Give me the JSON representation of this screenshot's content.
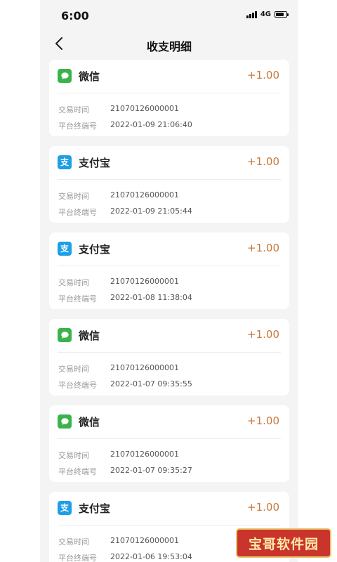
{
  "status_bar": {
    "time": "6:00",
    "network": "4G"
  },
  "header": {
    "title": "收支明细"
  },
  "transactions": [
    {
      "method": "微信",
      "icon": "wechat-icon",
      "amount": "+1.00",
      "label1": "交易时间",
      "value1": "21070126000001",
      "label2": "平台终端号",
      "value2": "2022-01-09 21:06:40"
    },
    {
      "method": "支付宝",
      "icon": "alipay-icon",
      "amount": "+1.00",
      "label1": "交易时间",
      "value1": "21070126000001",
      "label2": "平台终端号",
      "value2": "2022-01-09 21:05:44"
    },
    {
      "method": "支付宝",
      "icon": "alipay-icon",
      "amount": "+1.00",
      "label1": "交易时间",
      "value1": "21070126000001",
      "label2": "平台终端号",
      "value2": "2022-01-08 11:38:04"
    },
    {
      "method": "微信",
      "icon": "wechat-icon",
      "amount": "+1.00",
      "label1": "交易时间",
      "value1": "21070126000001",
      "label2": "平台终端号",
      "value2": "2022-01-07 09:35:55"
    },
    {
      "method": "微信",
      "icon": "wechat-icon",
      "amount": "+1.00",
      "label1": "交易时间",
      "value1": "21070126000001",
      "label2": "平台终端号",
      "value2": "2022-01-07 09:35:27"
    },
    {
      "method": "支付宝",
      "icon": "alipay-icon",
      "amount": "+1.00",
      "label1": "交易时间",
      "value1": "21070126000001",
      "label2": "平台终端号",
      "value2": "2022-01-06 19:53:04"
    }
  ],
  "colors": {
    "amount": "#c8773a",
    "wechat": "#3ab34a",
    "alipay": "#1d9fe6",
    "background": "#f4f4f4"
  },
  "watermark": {
    "text": "宝哥软件园"
  }
}
